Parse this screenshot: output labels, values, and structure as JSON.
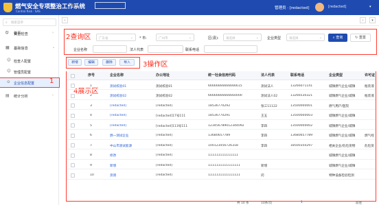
{
  "header": {
    "title": "燃气安全专项整治工作系统",
    "subtitle": "Control Risk · SAS",
    "user": "管理员 · [redacted]",
    "user_right": "[redacted]"
  },
  "sidebar": {
    "search_placeholder": "搜索菜单",
    "items": [
      {
        "label": "首页"
      },
      {
        "label": "安全检查"
      },
      {
        "label": "基础信息"
      },
      {
        "label": "检查人配置"
      },
      {
        "label": "管理员配置"
      },
      {
        "label": "企业信息配置"
      },
      {
        "label": "统计分析"
      }
    ]
  },
  "annotations": {
    "query": "2查询区",
    "op": "3操作区",
    "display": "4展示区",
    "menu": "1"
  },
  "tabs": {
    "home": "首页",
    "active": "企业信息配置",
    "right": "全部关闭"
  },
  "query": {
    "province_ph": "广东省",
    "city_label": "* 市:",
    "city_ph": "广州市",
    "district_label": "区(县):",
    "district_ph": "请选择",
    "type_label": "企业类型",
    "type_ph": "请选择",
    "name_label": "企业名称",
    "legal_label": "法人代表",
    "phone_label": "联系电话",
    "query_btn": "查询",
    "reset_btn": "重置"
  },
  "ops": [
    "新增",
    "编辑",
    "删除",
    "导入"
  ],
  "table": {
    "columns": [
      "序号",
      "企业名称",
      "办公地址",
      "统一社会信用代码",
      "法人代表",
      "联系电话",
      "企业类型",
      "许可证"
    ],
    "rows": [
      {
        "no": "1",
        "name": "测试校验01",
        "addr": "测试校验01",
        "code": "66666666666666615",
        "legal": "测试法人",
        "phone": "13266071141",
        "type": "城镇燃气企业/城镇",
        "lic": "瓶装液"
      },
      {
        "no": "2",
        "name": "测试校验02",
        "addr": "测试校验02",
        "code": "66666666666660000",
        "legal": "测试法人02",
        "phone": "13266530321",
        "type": "城镇燃气企业/城镇",
        "lic": "瓶装液"
      },
      {
        "no": "3",
        "name": "[redacted]",
        "addr": "[redacted]",
        "code": "18536770292",
        "legal": "张三11122",
        "phone": "13500000001",
        "type": "燃气用户/医院",
        "lic": ""
      },
      {
        "no": "4",
        "name": "[redacted]",
        "addr": "[redacted]17号111",
        "code": "18536770291",
        "legal": "王五",
        "phone": "13500000003",
        "type": "城镇燃气企业/城镇",
        "lic": ""
      },
      {
        "no": "5",
        "name": "[redacted]",
        "addr": "[redacted]113号111",
        "code": "123456789012344092",
        "legal": "李四",
        "phone": "13500000002",
        "type": "城镇燃气企业/城镇",
        "lic": ""
      },
      {
        "no": "6",
        "name": "燃一测试企业",
        "addr": "[redacted]",
        "code": "13680657789",
        "legal": "李四",
        "phone": "13680657789",
        "type": "城镇燃气企业/城镇",
        "lic": "燃气经"
      },
      {
        "no": "7",
        "name": "中山市测试能源",
        "addr": "[redacted]",
        "code": "100123456726318",
        "legal": "李四",
        "phone": "18500350297",
        "type": "相关企业/危险货物",
        "lic": "危险货"
      },
      {
        "no": "8",
        "name": "修改",
        "addr": "[redacted]",
        "code": "111111111111111",
        "legal": "",
        "phone": "",
        "type": "城镇燃气企业/城镇",
        "lic": ""
      },
      {
        "no": "9",
        "name": "新增",
        "addr": "[redacted]",
        "code": "1111111111111111",
        "legal": "新增",
        "phone": "",
        "type": "城镇燃气企业/城镇",
        "lic": ""
      },
      {
        "no": "10",
        "name": "测测",
        "addr": "[redacted]",
        "code": "1111111111111111",
        "legal": "问",
        "phone": "",
        "type": "特种设备检验检测",
        "lic": ""
      }
    ]
  },
  "pager": {
    "total": "共 10 条",
    "size": "10条/页",
    "page": "1",
    "goto": "前往"
  }
}
